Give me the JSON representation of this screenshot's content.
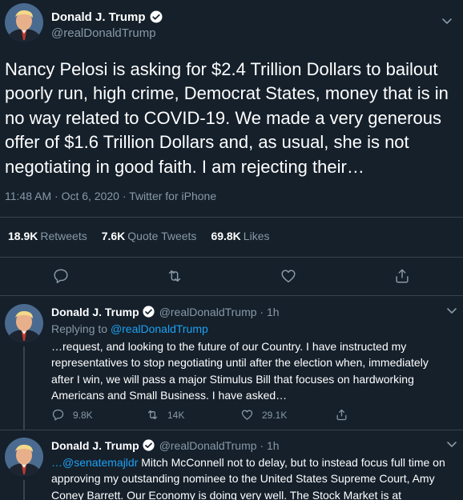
{
  "main_tweet": {
    "author_name": "Donald J. Trump",
    "handle": "@realDonaldTrump",
    "text": "Nancy Pelosi is asking for $2.4 Trillion Dollars to bailout poorly run, high crime, Democrat States, money that is in no way related to COVID-19. We made a very generous offer of $1.6 Trillion Dollars and, as usual, she is not negotiating in good faith. I am rejecting their…",
    "time": "11:48 AM",
    "date": "Oct 6, 2020",
    "source": "Twitter for iPhone",
    "retweets_count": "18.9K",
    "retweets_label": "Retweets",
    "quote_count": "7.6K",
    "quote_label": "Quote Tweets",
    "likes_count": "69.8K",
    "likes_label": "Likes"
  },
  "replies": [
    {
      "author_name": "Donald J. Trump",
      "handle_time": "@realDonaldTrump · 1h",
      "replying_prefix": "Replying to",
      "replying_handle": "@realDonaldTrump",
      "text": "…request, and looking to the future of our Country. I have instructed my representatives to stop negotiating until after the election when, immediately after I win, we will pass a major Stimulus Bill that focuses on hardworking Americans and Small Business. I have asked…",
      "reply_count": "9.8K",
      "retweet_count": "14K",
      "like_count": "29.1K"
    },
    {
      "author_name": "Donald J. Trump",
      "handle_time": "@realDonaldTrump · 1h",
      "text_prefix": "…",
      "mention": "@senatemajldr",
      "text": " Mitch McConnell not to delay, but to instead focus full time on approving my outstanding nominee to the United States Supreme Court, Amy Coney Barrett. Our Economy is doing very well. The Stock Market is at"
    }
  ],
  "icons": {
    "verified": "verified-badge-icon",
    "more": "chevron-down-icon",
    "reply": "reply-icon",
    "retweet": "retweet-icon",
    "like": "heart-icon",
    "share": "share-icon"
  },
  "colors": {
    "background": "#15202b",
    "text": "#ffffff",
    "secondary": "#8899a6",
    "link": "#1da1f2",
    "border": "#38444d"
  }
}
